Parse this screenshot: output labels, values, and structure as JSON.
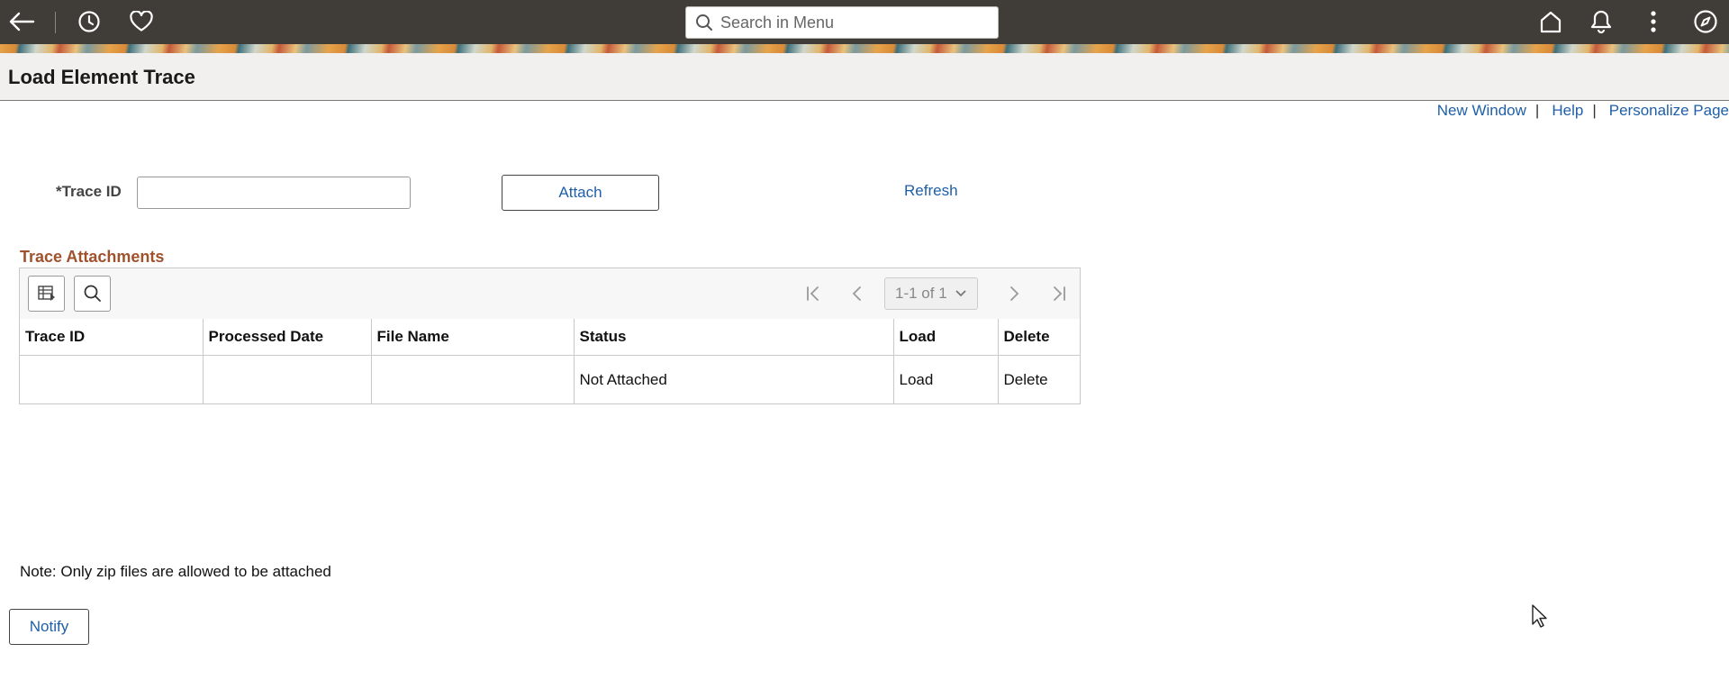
{
  "topbar": {
    "icons": [
      "back-arrow-icon",
      "history-icon",
      "favorites-icon",
      "home-icon",
      "notifications-icon",
      "actions-menu-icon",
      "navigator-icon"
    ],
    "search_placeholder": "Search in Menu",
    "background_color": "#403c38"
  },
  "page": {
    "title": "Load Element Trace"
  },
  "top_links": {
    "new_window": "New Window",
    "help": "Help",
    "personalize": "Personalize Page",
    "separator": "|"
  },
  "form": {
    "trace_id_label": "*Trace ID",
    "trace_id_value": "",
    "attach_label": "Attach",
    "refresh_label": "Refresh"
  },
  "grid": {
    "title": "Trace Attachments",
    "pager_text": "1-1 of 1",
    "columns": [
      "Trace ID",
      "Processed Date",
      "File Name",
      "Status",
      "Load",
      "Delete"
    ],
    "rows": [
      [
        "",
        "",
        "",
        "Not Attached",
        "Load",
        "Delete"
      ]
    ]
  },
  "note": "Note: Only zip files are allowed to be attached",
  "notify_label": "Notify",
  "colors": {
    "link": "#1f5fa8",
    "section_title": "#a0522d",
    "header_bg": "#f1f0ef"
  }
}
